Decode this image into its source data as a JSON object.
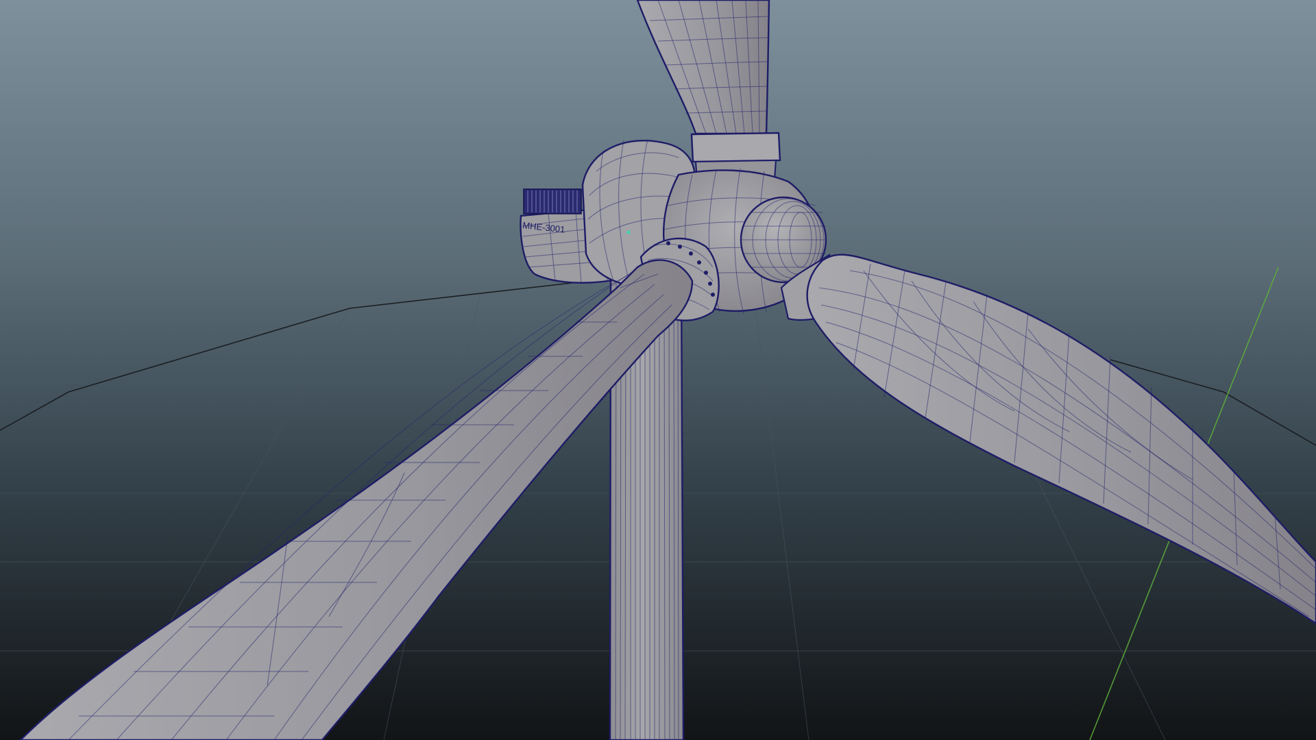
{
  "viewport": {
    "label": "maya-perspective-viewport",
    "background_top": "#7d909c",
    "background_bottom": "#121416",
    "axis_color": "#5eb13a",
    "mesh_fill": "#9a9aa0",
    "wire_color": "#24236e"
  },
  "model": {
    "name": "wind-turbine",
    "nacelle_label": "MHE-3001"
  },
  "icons": {
    "pivot": "pivot-dot-icon"
  }
}
